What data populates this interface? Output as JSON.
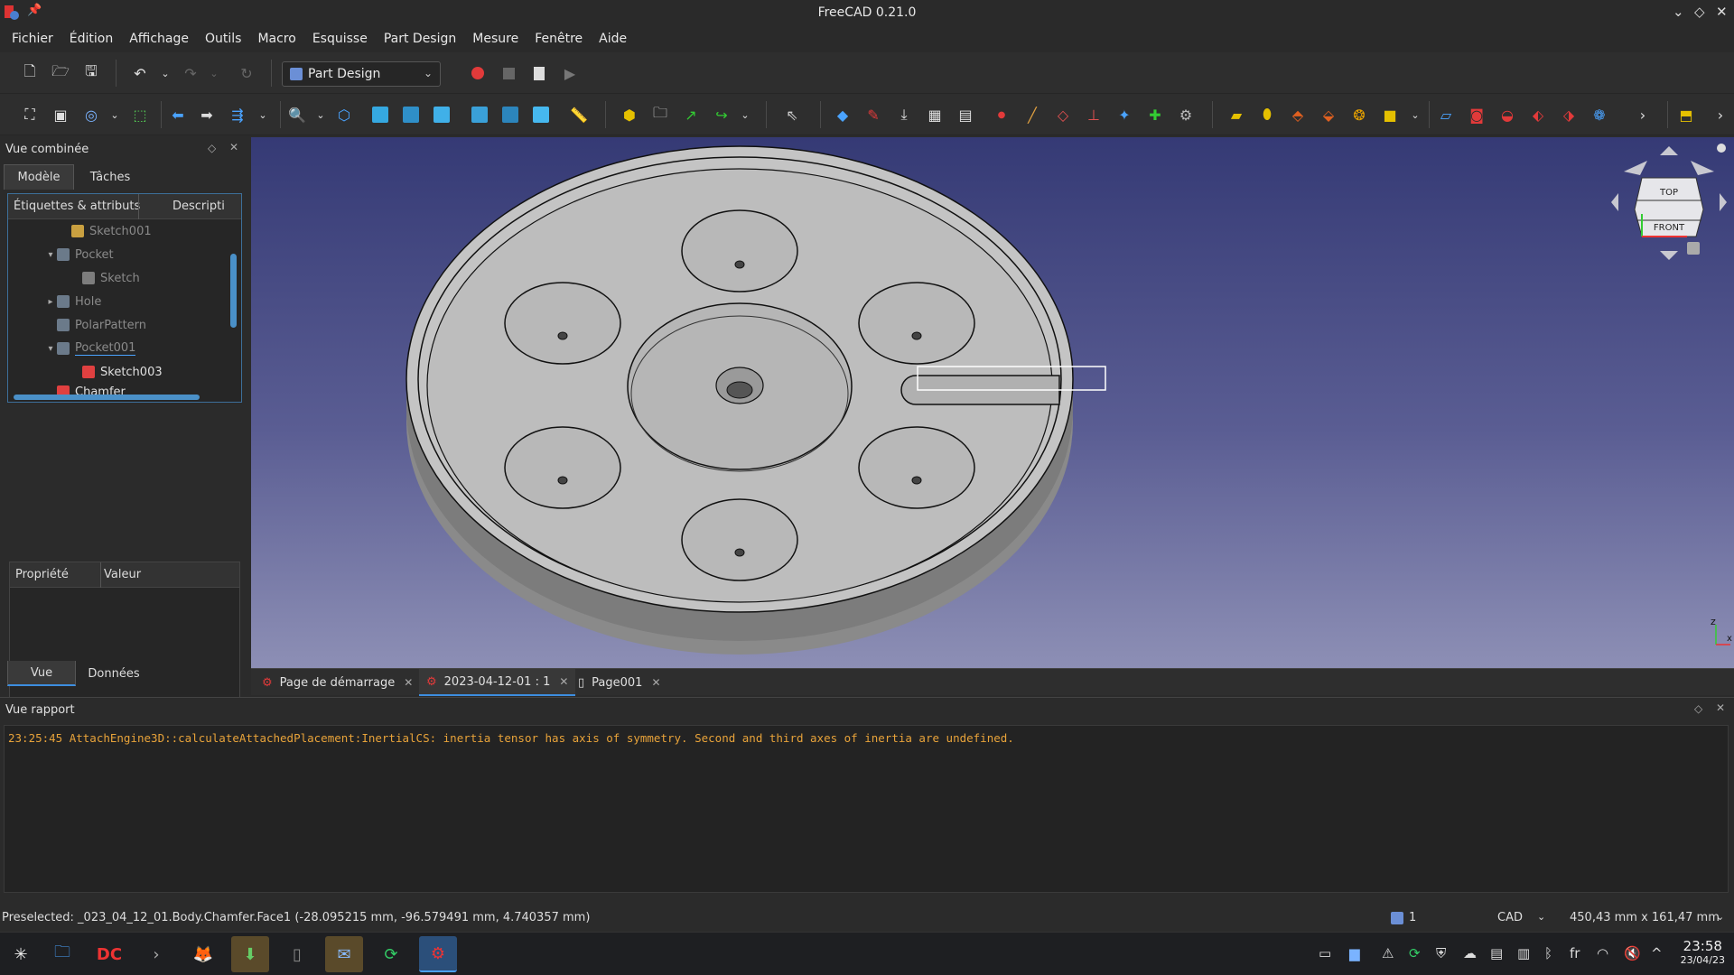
{
  "window": {
    "title": "FreeCAD 0.21.0"
  },
  "menu": [
    "Fichier",
    "Édition",
    "Affichage",
    "Outils",
    "Macro",
    "Esquisse",
    "Part Design",
    "Mesure",
    "Fenêtre",
    "Aide"
  ],
  "workbench": {
    "selected": "Part Design"
  },
  "combo": {
    "title": "Vue combinée",
    "tabs": [
      "Modèle",
      "Tâches"
    ],
    "tree_headers": [
      "Étiquettes & attributs",
      "Descripti"
    ],
    "tree_items": [
      {
        "label": "Sketch001",
        "icon": "sketch-icon",
        "dim": true
      },
      {
        "label": "Pocket",
        "icon": "pocket-icon",
        "dim": true
      },
      {
        "label": "Sketch",
        "icon": "sketch-icon",
        "dim": true
      },
      {
        "label": "Hole",
        "icon": "hole-icon",
        "dim": true
      },
      {
        "label": "PolarPattern",
        "icon": "polar-pattern-icon",
        "dim": true
      },
      {
        "label": "Pocket001",
        "icon": "pocket-icon",
        "dim": true
      },
      {
        "label": "Sketch003",
        "icon": "sketch-icon",
        "dim": false
      },
      {
        "label": "Chamfer",
        "icon": "chamfer-icon",
        "dim": false
      }
    ],
    "prop_headers": [
      "Propriété",
      "Valeur"
    ],
    "bottom_tabs": [
      "Vue",
      "Données"
    ]
  },
  "navcube": {
    "top": "TOP",
    "front": "FRONT",
    "axis_z": "z",
    "axis_x": "x"
  },
  "doc_tabs": [
    {
      "label": "Page de démarrage",
      "active": false
    },
    {
      "label": "2023-04-12-01 : 1",
      "active": true
    },
    {
      "label": "Page001",
      "active": false
    }
  ],
  "report": {
    "title": "Vue rapport",
    "message": "23:25:45  AttachEngine3D::calculateAttachedPlacement:InertialCS: inertia tensor has axis of symmetry. Second and third axes of inertia are undefined."
  },
  "status": {
    "preselected": "Preselected: _023_04_12_01.Body.Chamfer.Face1 (-28.095215 mm, -96.579491 mm, 4.740357 mm)",
    "count": "1",
    "nav_style": "CAD",
    "dimensions": "450,43 mm x 161,47 mm"
  },
  "taskbar": {
    "lang": "fr",
    "time": "23:58",
    "date": "23/04/23"
  },
  "colors": {
    "accent": "#3d8ee0",
    "report_warning": "#e8a33a",
    "viewport_top": "#353a75",
    "viewport_bottom": "#8d8fb5"
  }
}
